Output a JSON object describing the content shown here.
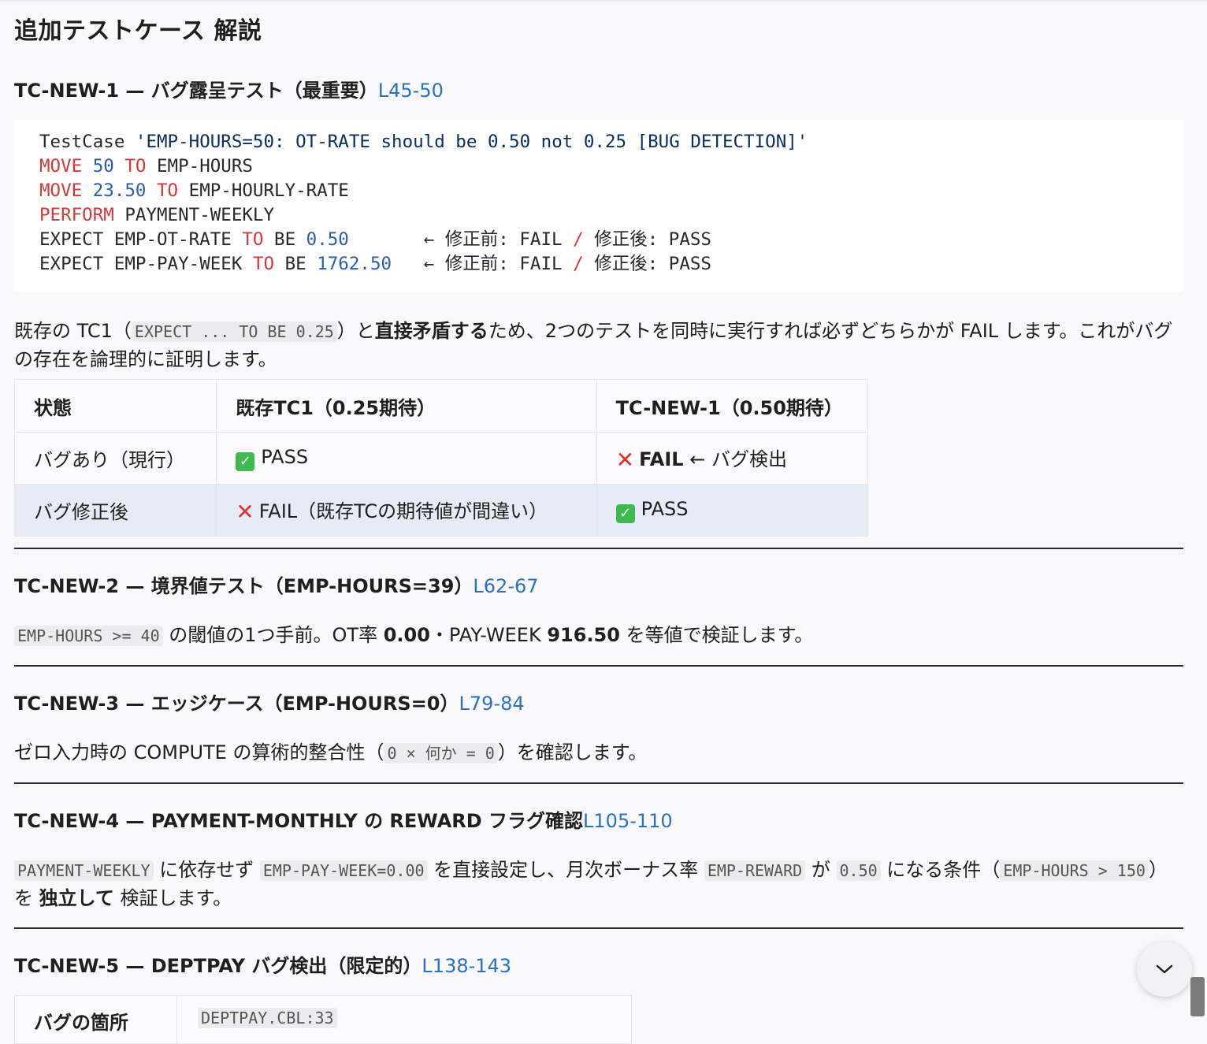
{
  "page_title": "追加テストケース 解説",
  "tc1": {
    "heading": "TC-NEW-1 — バグ露呈テスト（最重要）",
    "ref": "L45-50",
    "code": {
      "l1_prefix": "TestCase ",
      "l1_string": "'EMP-HOURS=50: OT-RATE should be 0.50 not 0.25 [BUG DETECTION]'",
      "l2": [
        "MOVE",
        " ",
        "50",
        " ",
        "TO",
        " EMP-HOURS"
      ],
      "l3": [
        "MOVE",
        " ",
        "23.50",
        " ",
        "TO",
        " EMP-HOURLY-RATE"
      ],
      "l4": [
        "PERFORM",
        " PAYMENT-WEEKLY"
      ],
      "l5": [
        "EXPECT EMP-OT-RATE ",
        "TO",
        " BE ",
        "0.50",
        "       ← 修正前: FAIL ",
        "/",
        " 修正後: PASS"
      ],
      "l6": [
        "EXPECT EMP-PAY-WEEK ",
        "TO",
        " BE ",
        "1762.50",
        "   ← 修正前: FAIL ",
        "/",
        " 修正後: PASS"
      ]
    },
    "para": {
      "t1": "既存の TC1（",
      "c1": "EXPECT ... TO BE 0.25",
      "t2": "）と",
      "b1": "直接矛盾する",
      "t3": "ため、2つのテストを同時に実行すれば必ずどちらかが FAIL します。これがバグの存在を論理的に証明します。"
    },
    "table": {
      "headers": [
        "状態",
        "既存TC1（0.25期待）",
        "TC-NEW-1（0.50期待）"
      ],
      "rows": [
        {
          "state": "バグあり（現行）",
          "tc1_icon": "check-icon",
          "tc1": "PASS",
          "new_icon": "cross-icon",
          "new_bold": "FAIL",
          "new_rest": " ← バグ検出"
        },
        {
          "state": "バグ修正後",
          "tc1_icon": "cross-icon",
          "tc1": "FAIL（既存TCの期待値が間違い）",
          "new_icon": "check-icon",
          "new": "PASS"
        }
      ]
    }
  },
  "tc2": {
    "heading": "TC-NEW-2 — 境界値テスト（EMP-HOURS=39）",
    "ref": "L62-67",
    "para": {
      "c1": "EMP-HOURS >= 40",
      "t1": " の閾値の1つ手前。OT率 ",
      "b1": "0.00",
      "t2": "・PAY-WEEK ",
      "b2": "916.50",
      "t3": " を等値で検証します。"
    }
  },
  "tc3": {
    "heading": "TC-NEW-3 — エッジケース（EMP-HOURS=0）",
    "ref": "L79-84",
    "para": {
      "t1": "ゼロ入力時の COMPUTE の算術的整合性（",
      "c1": "0 × 何か = 0",
      "t2": "）を確認します。"
    }
  },
  "tc4": {
    "heading": "TC-NEW-4 — PAYMENT-MONTHLY の REWARD フラグ確認",
    "ref": "L105-110",
    "para": {
      "c1": "PAYMENT-WEEKLY",
      "t1": " に依存せず ",
      "c2": "EMP-PAY-WEEK=0.00",
      "t2": " を直接設定し、月次ボーナス率 ",
      "c3": "EMP-REWARD",
      "t3": " が ",
      "c4": "0.50",
      "t4": " になる条件（",
      "c5": "EMP-HOURS > 150",
      "t5": "）を ",
      "b1": "独立して",
      "t6": " 検証します。"
    }
  },
  "tc5": {
    "heading": "TC-NEW-5 — DEPTPAY バグ検出（限定的）",
    "ref": "L138-143",
    "table_partial": {
      "c1": "バグの箇所",
      "c2": "DEPTPAY.CBL:33"
    }
  },
  "colors": {
    "accent": "#2f6fbf",
    "keyword": "#cf3a3a",
    "number": "#2a5db0",
    "highlight_row": "#e6ebf5"
  }
}
